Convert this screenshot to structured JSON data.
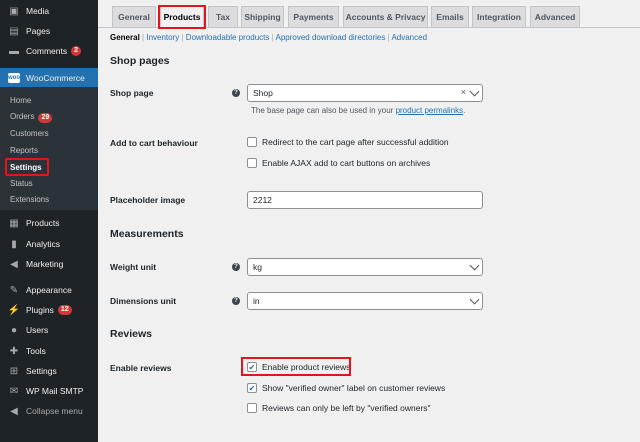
{
  "sidebar": {
    "top_items": [
      {
        "label": "Media",
        "icon": "media-icon"
      },
      {
        "label": "Pages",
        "icon": "pages-icon"
      },
      {
        "label": "Comments",
        "icon": "comments-icon",
        "badge": "2"
      }
    ],
    "woocommerce": {
      "label": "WooCommerce",
      "logo": "woo",
      "icon": "woocommerce-icon"
    },
    "wc_submenu": [
      {
        "label": "Home"
      },
      {
        "label": "Orders",
        "badge": "29"
      },
      {
        "label": "Customers"
      },
      {
        "label": "Reports"
      },
      {
        "label": "Settings"
      },
      {
        "label": "Status"
      },
      {
        "label": "Extensions"
      }
    ],
    "bottom_items": [
      {
        "label": "Products",
        "icon": "products-icon"
      },
      {
        "label": "Analytics",
        "icon": "analytics-icon"
      },
      {
        "label": "Marketing",
        "icon": "marketing-icon"
      },
      {
        "label": "Appearance",
        "icon": "appearance-icon"
      },
      {
        "label": "Plugins",
        "icon": "plugins-icon",
        "badge": "12"
      },
      {
        "label": "Users",
        "icon": "users-icon"
      },
      {
        "label": "Tools",
        "icon": "tools-icon"
      },
      {
        "label": "Settings",
        "icon": "settings-icon"
      },
      {
        "label": "WP Mail SMTP",
        "icon": "mail-icon"
      },
      {
        "label": "Collapse menu",
        "icon": "collapse-icon"
      }
    ]
  },
  "tabs": [
    "General",
    "Products",
    "Tax",
    "Shipping",
    "Payments",
    "Accounts & Privacy",
    "Emails",
    "Integration",
    "Advanced"
  ],
  "subsections": [
    "General",
    "Inventory",
    "Downloadable products",
    "Approved download directories",
    "Advanced"
  ],
  "shop_pages": {
    "heading": "Shop pages",
    "shop_page_label": "Shop page",
    "shop_page_value": "Shop",
    "shop_page_desc_prefix": "The base page can also be used in your",
    "shop_page_desc_link": "product permalinks",
    "shop_page_desc_suffix": ".",
    "add_to_cart_label": "Add to cart behaviour",
    "redirect_label": "Redirect to the cart page after successful addition",
    "ajax_label": "Enable AJAX add to cart buttons on archives",
    "placeholder_label": "Placeholder image",
    "placeholder_value": "2212"
  },
  "measurements": {
    "heading": "Measurements",
    "weight_label": "Weight unit",
    "weight_value": "kg",
    "dimensions_label": "Dimensions unit",
    "dimensions_value": "in"
  },
  "reviews": {
    "heading": "Reviews",
    "enable_label": "Enable reviews",
    "enable_product_reviews": "Enable product reviews",
    "verified_owner_label": "Show \"verified owner\" label on customer reviews",
    "verified_only_label": "Reviews can only be left by \"verified owners\""
  },
  "colors": {
    "accent": "#2271b1",
    "highlight": "#e3141b",
    "sidebar_bg": "#1d2327",
    "badge": "#d63638"
  }
}
